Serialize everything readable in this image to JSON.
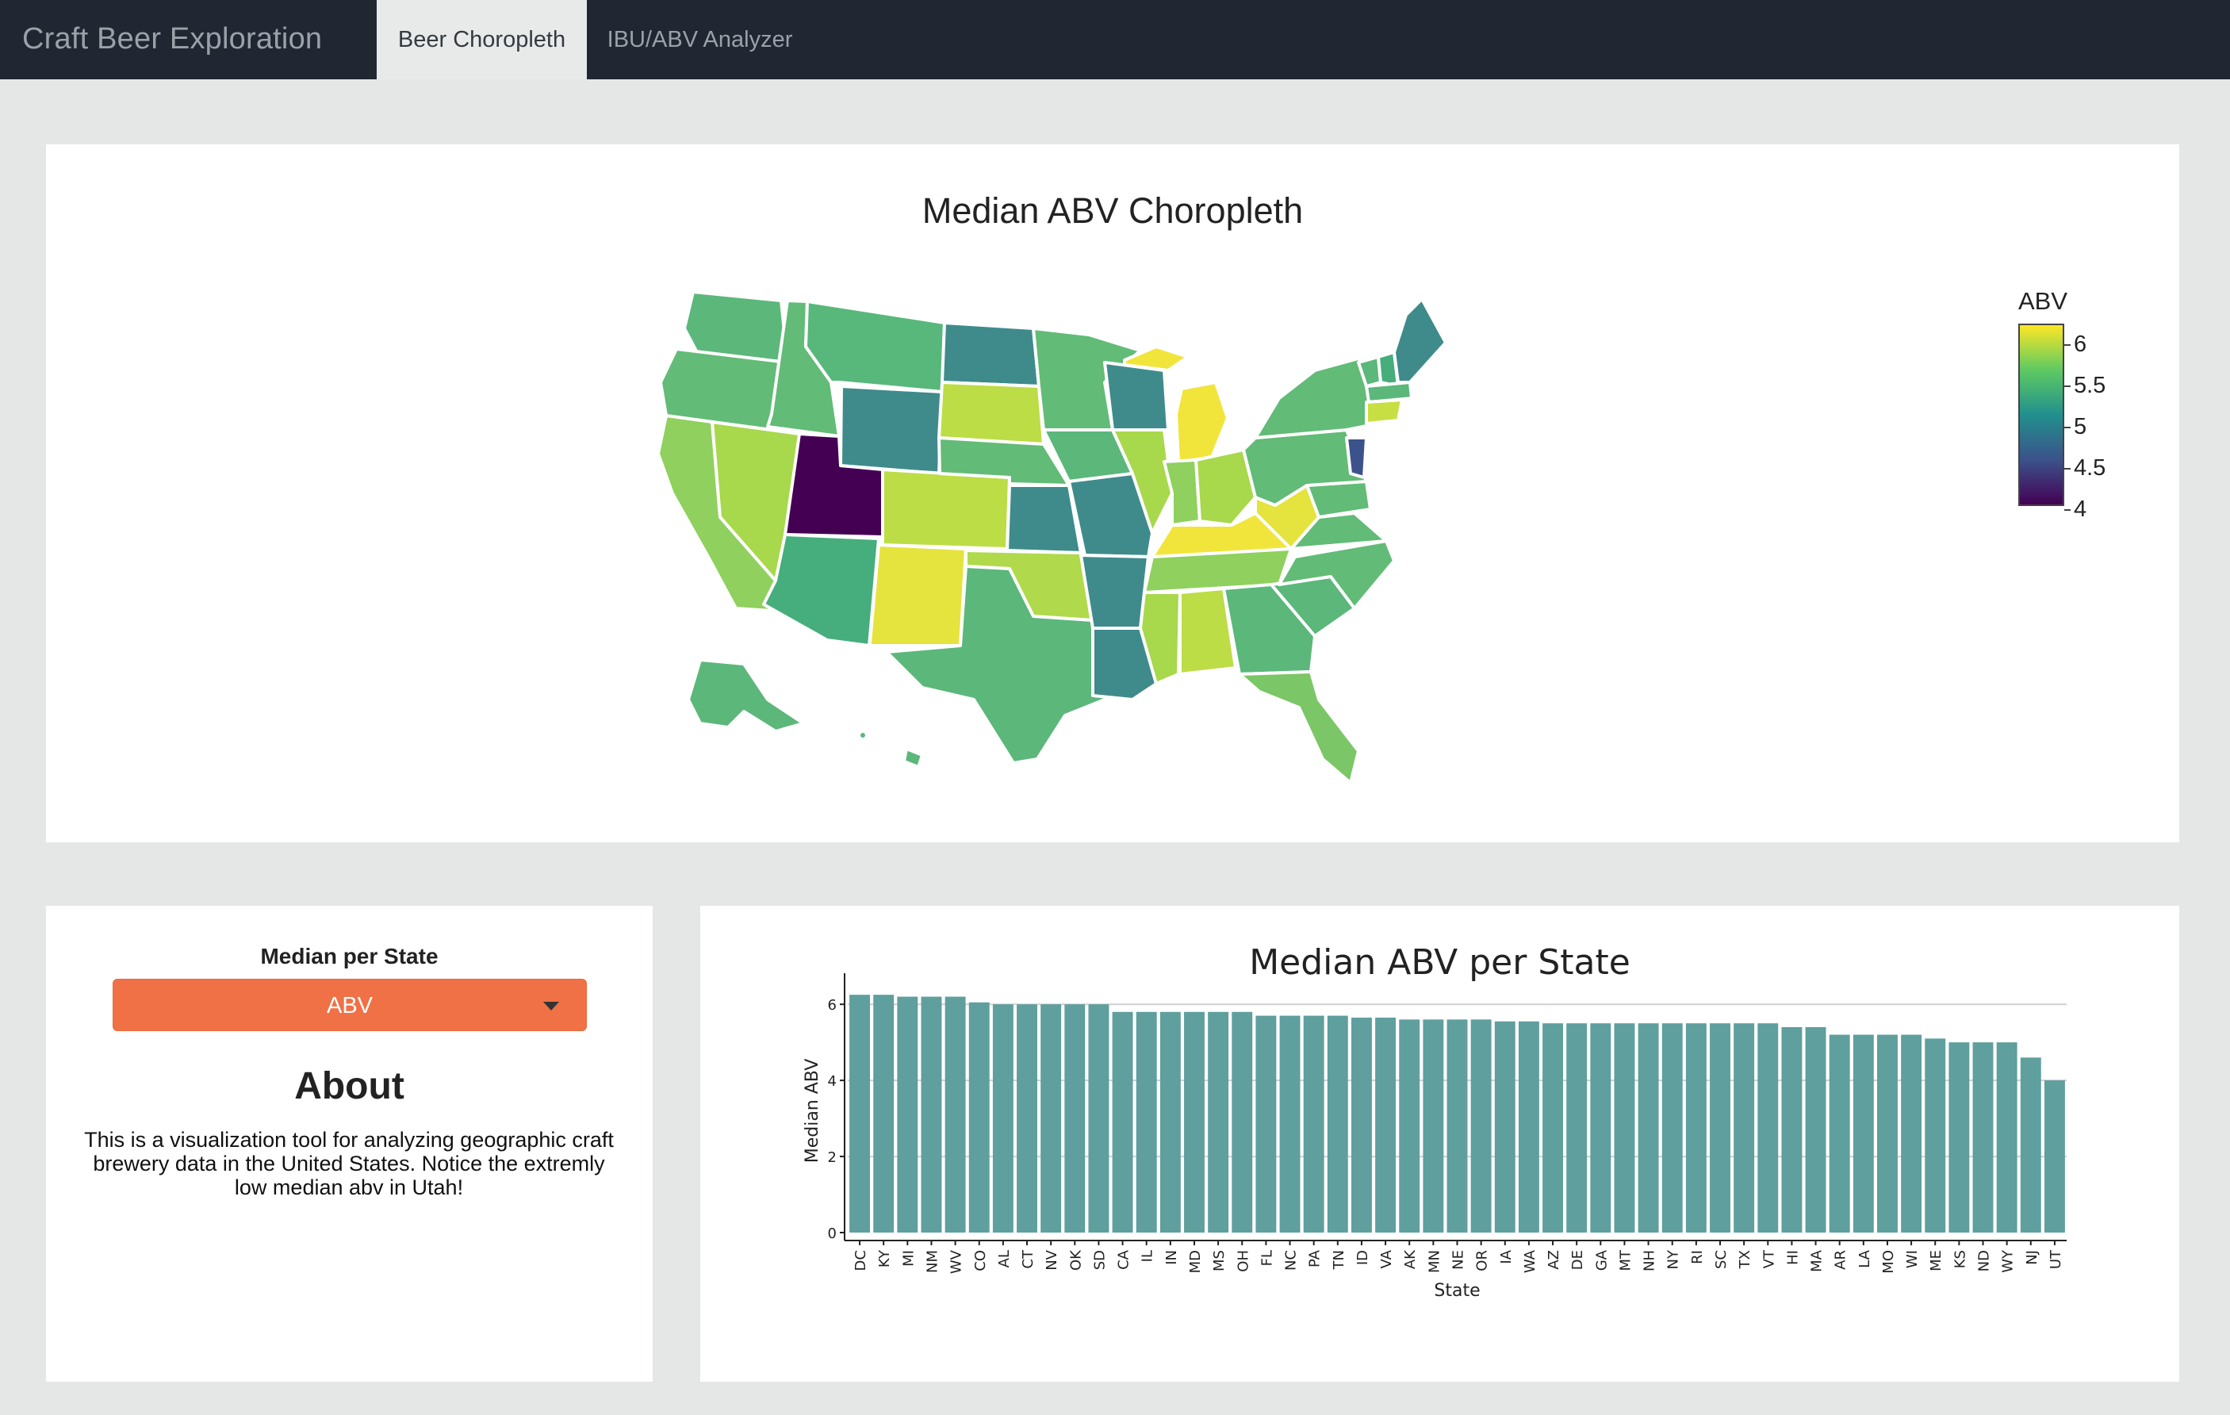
{
  "nav": {
    "brand": "Craft Beer Exploration",
    "tabs": [
      {
        "label": "Beer Choropleth",
        "active": true
      },
      {
        "label": "IBU/ABV Analyzer",
        "active": false
      }
    ]
  },
  "choropleth": {
    "title": "Median ABV Choropleth",
    "legend": {
      "title": "ABV",
      "ticks": [
        "6",
        "5.5",
        "5",
        "4.5",
        "4"
      ],
      "colorscale": "viridis",
      "range": [
        4,
        6.2
      ]
    }
  },
  "controls": {
    "label": "Median per State",
    "dropdown_value": "ABV",
    "dropdown_color": "#ef7145"
  },
  "about": {
    "title": "About",
    "text": "This is a visualization tool for analyzing geographic craft brewery data in the United States. Notice the extremly low median abv in Utah!"
  },
  "chart_data": {
    "type": "bar",
    "title": "Median ABV per State",
    "xlabel": "State",
    "ylabel": "Median ABV",
    "ylim": [
      0,
      6.4
    ],
    "yticks": [
      0,
      2,
      4,
      6
    ],
    "bar_color": "#5f9f9e",
    "categories": [
      "DC",
      "KY",
      "MI",
      "NM",
      "WV",
      "CO",
      "AL",
      "CT",
      "NV",
      "OK",
      "SD",
      "CA",
      "IL",
      "IN",
      "MD",
      "MS",
      "OH",
      "FL",
      "NC",
      "PA",
      "TN",
      "ID",
      "VA",
      "AK",
      "MN",
      "NE",
      "OR",
      "IA",
      "WA",
      "AZ",
      "DE",
      "GA",
      "MT",
      "NH",
      "NY",
      "RI",
      "SC",
      "TX",
      "VT",
      "HI",
      "MA",
      "AR",
      "LA",
      "MO",
      "WI",
      "ME",
      "KS",
      "ND",
      "WY",
      "NJ",
      "UT"
    ],
    "values": [
      6.25,
      6.25,
      6.2,
      6.2,
      6.2,
      6.05,
      6.0,
      6.0,
      6.0,
      6.0,
      6.0,
      5.8,
      5.8,
      5.8,
      5.8,
      5.8,
      5.8,
      5.7,
      5.7,
      5.7,
      5.7,
      5.65,
      5.65,
      5.6,
      5.6,
      5.6,
      5.6,
      5.55,
      5.55,
      5.5,
      5.5,
      5.5,
      5.5,
      5.5,
      5.5,
      5.5,
      5.5,
      5.5,
      5.5,
      5.4,
      5.4,
      5.2,
      5.2,
      5.2,
      5.2,
      5.1,
      5.0,
      5.0,
      5.0,
      4.6,
      4.0
    ]
  }
}
